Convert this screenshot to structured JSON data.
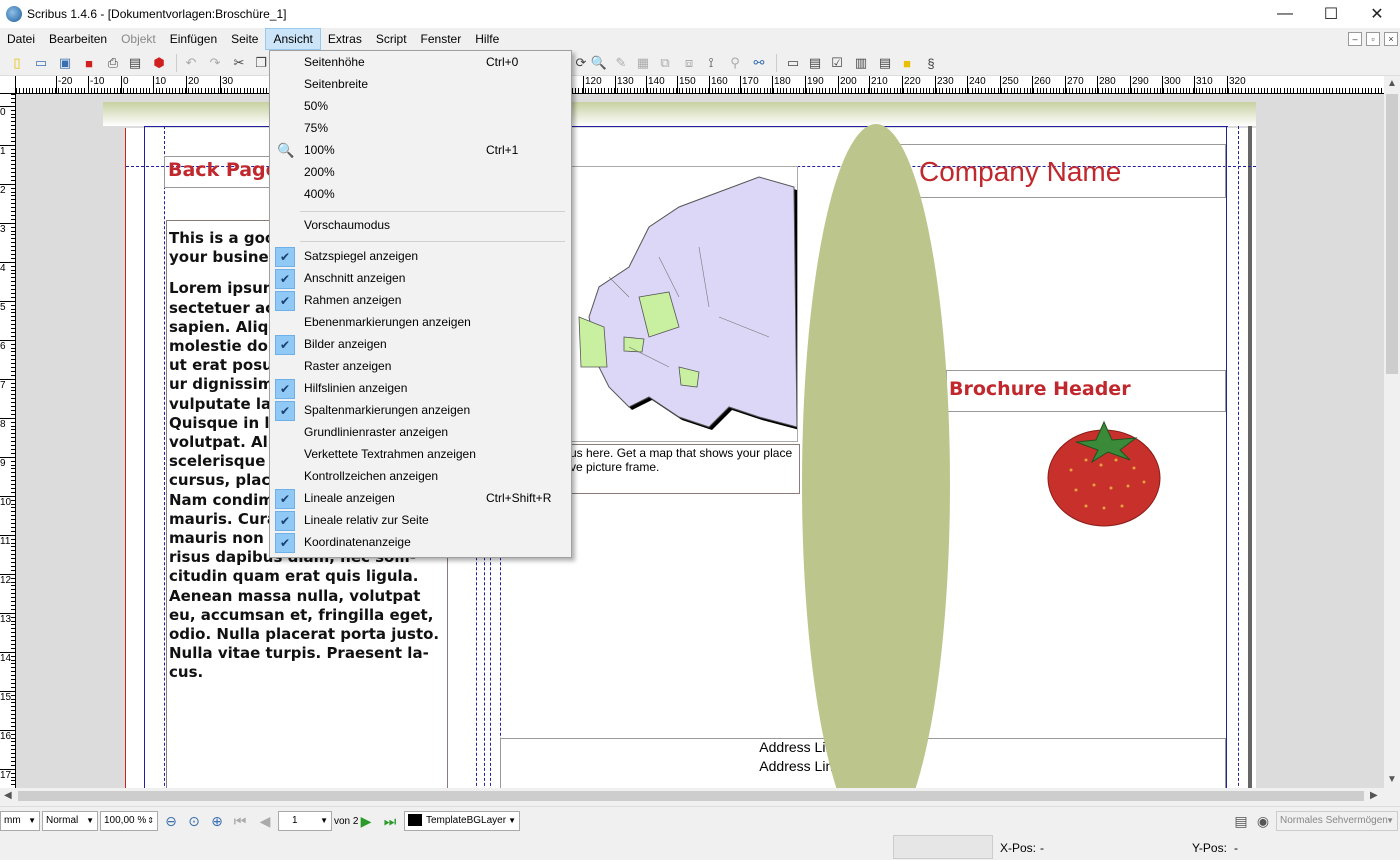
{
  "window": {
    "title": "Scribus 1.4.6 - [Dokumentvorlagen:Broschüre_1]",
    "minimize": "—",
    "maximize": "☐",
    "close": "✕"
  },
  "menubar": [
    {
      "label": "Datei",
      "disabled": false
    },
    {
      "label": "Bearbeiten",
      "disabled": false
    },
    {
      "label": "Objekt",
      "disabled": true
    },
    {
      "label": "Einfügen",
      "disabled": false
    },
    {
      "label": "Seite",
      "disabled": false
    },
    {
      "label": "Ansicht",
      "active": true
    },
    {
      "label": "Extras",
      "disabled": false
    },
    {
      "label": "Script",
      "disabled": false
    },
    {
      "label": "Fenster",
      "disabled": false
    },
    {
      "label": "Hilfe",
      "disabled": false
    }
  ],
  "view_menu": {
    "items": [
      {
        "label": "Seitenhöhe",
        "shortcut": "Ctrl+0",
        "checked": false
      },
      {
        "label": "Seitenbreite",
        "shortcut": "",
        "checked": false
      },
      {
        "label": "50%",
        "shortcut": "",
        "checked": false
      },
      {
        "label": "75%",
        "shortcut": "",
        "checked": false
      },
      {
        "label": "100%",
        "shortcut": "Ctrl+1",
        "checked": false,
        "icon": "zoom-icon"
      },
      {
        "label": "200%",
        "shortcut": "",
        "checked": false
      },
      {
        "label": "400%",
        "shortcut": "",
        "checked": false
      },
      {
        "label": "Vorschaumodus",
        "shortcut": "",
        "checked": false
      },
      {
        "label": "Satzspiegel anzeigen",
        "shortcut": "",
        "checked": true
      },
      {
        "label": "Anschnitt anzeigen",
        "shortcut": "",
        "checked": true
      },
      {
        "label": "Rahmen anzeigen",
        "shortcut": "",
        "checked": true
      },
      {
        "label": "Ebenenmarkierungen anzeigen",
        "shortcut": "",
        "checked": false
      },
      {
        "label": "Bilder anzeigen",
        "shortcut": "",
        "checked": true
      },
      {
        "label": "Raster anzeigen",
        "shortcut": "",
        "checked": false
      },
      {
        "label": "Hilfslinien anzeigen",
        "shortcut": "",
        "checked": true
      },
      {
        "label": "Spaltenmarkierungen anzeigen",
        "shortcut": "",
        "checked": true
      },
      {
        "label": "Grundlinienraster anzeigen",
        "shortcut": "",
        "checked": false
      },
      {
        "label": "Verkettete Textrahmen anzeigen",
        "shortcut": "",
        "checked": false
      },
      {
        "label": "Kontrollzeichen anzeigen",
        "shortcut": "",
        "checked": false
      },
      {
        "label": "Lineale anzeigen",
        "shortcut": "Ctrl+Shift+R",
        "checked": true
      },
      {
        "label": "Lineale relativ zur Seite",
        "shortcut": "",
        "checked": true
      },
      {
        "label": "Koordinatenanzeige",
        "shortcut": "",
        "checked": true
      }
    ]
  },
  "rulers": {
    "h_labels": [
      "-20",
      "-10",
      "0",
      "10",
      "20",
      "30",
      "120",
      "130",
      "140",
      "150",
      "160",
      "170",
      "180",
      "190",
      "200",
      "210",
      "220",
      "230",
      "240",
      "250",
      "260",
      "270",
      "280",
      "290",
      "300",
      "310",
      "320"
    ],
    "v_labels": [
      "0",
      "1",
      "2",
      "3",
      "4",
      "5",
      "6",
      "7",
      "8",
      "9",
      "10",
      "11",
      "12",
      "13",
      "14",
      "15",
      "16",
      "17"
    ]
  },
  "document": {
    "back_page_heading": "Back Page",
    "back_page_intro": "This is a goo\nyour busines",
    "back_page_body": "Lorem ipsun\nsectetuer ac\nsapien. Aliq\nmolestie dol\nut erat posu\nur dignissim\nvulputate la\nQuisque in li\nvolutpat. Ali\nscelerisque\ncursus, plac\nNam condim\nmauris. Cura\nmauris non c\nrisus dapibus diam, nec solli-\ncitudin quam erat quis ligula.\nAenean massa nulla, volutpat\neu, accumsan et, fringilla eget,\nodio. Nulla placerat porta justo.\nNulla vitae turpis. Praesent la-\ncus.",
    "map_caption": "us here. Get a map that shows your place\nve picture frame.",
    "company_name": "Company Name",
    "brochure_header": "Brochure Header",
    "address_line1": "Address Line 1",
    "address_line2": "Address Line 2"
  },
  "statusbar": {
    "unit": "mm",
    "mode": "Normal",
    "zoom": "100,00 %",
    "page_current": "1",
    "page_of": "von 2",
    "layer": "TemplateBGLayer",
    "vision": "Normales Sehvermögen",
    "xpos_label": "X-Pos:",
    "xpos_value": "-",
    "ypos_label": "Y-Pos:",
    "ypos_value": "-"
  },
  "colors": {
    "accent_red": "#c0282d",
    "ellipse_green": "#bcc68c",
    "map_fill": "#dcd6f7",
    "map_highlight": "#c8f0a0",
    "menu_check": "#90c8f6"
  }
}
